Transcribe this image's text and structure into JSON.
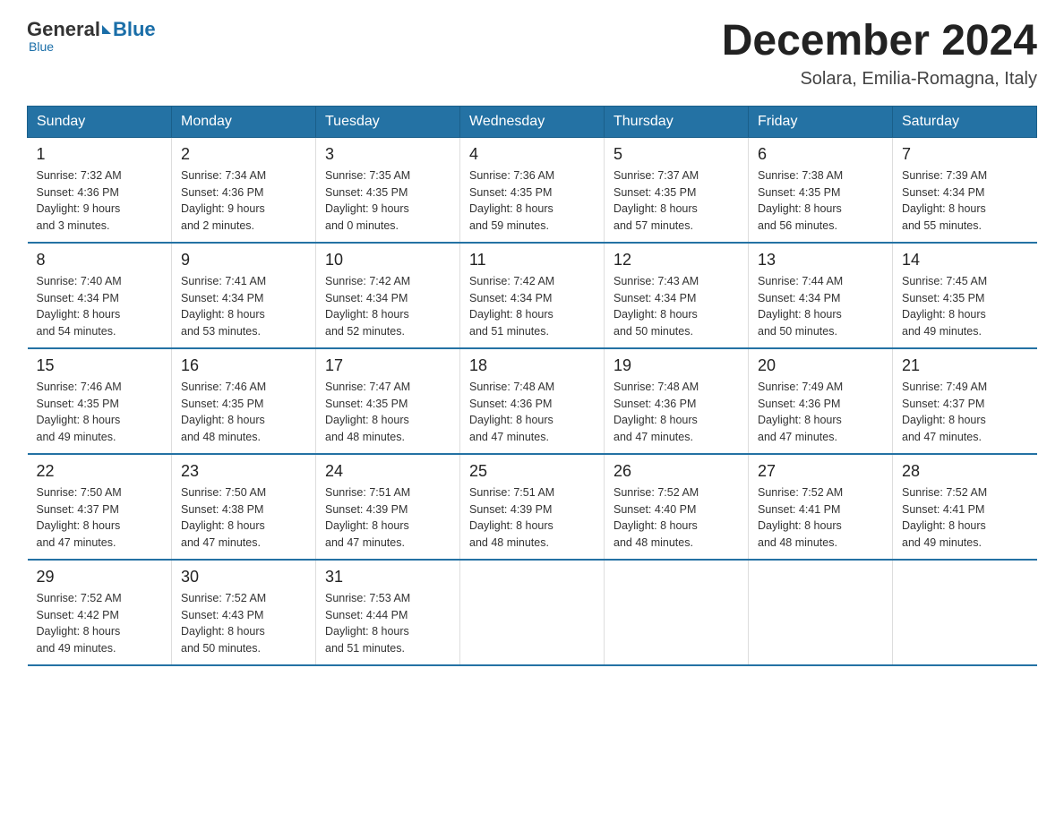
{
  "header": {
    "logo_general": "General",
    "logo_blue": "Blue",
    "month_title": "December 2024",
    "location": "Solara, Emilia-Romagna, Italy"
  },
  "days_of_week": [
    "Sunday",
    "Monday",
    "Tuesday",
    "Wednesday",
    "Thursday",
    "Friday",
    "Saturday"
  ],
  "weeks": [
    [
      {
        "day": "1",
        "sunrise": "7:32 AM",
        "sunset": "4:36 PM",
        "daylight": "9 hours and 3 minutes."
      },
      {
        "day": "2",
        "sunrise": "7:34 AM",
        "sunset": "4:36 PM",
        "daylight": "9 hours and 2 minutes."
      },
      {
        "day": "3",
        "sunrise": "7:35 AM",
        "sunset": "4:35 PM",
        "daylight": "9 hours and 0 minutes."
      },
      {
        "day": "4",
        "sunrise": "7:36 AM",
        "sunset": "4:35 PM",
        "daylight": "8 hours and 59 minutes."
      },
      {
        "day": "5",
        "sunrise": "7:37 AM",
        "sunset": "4:35 PM",
        "daylight": "8 hours and 57 minutes."
      },
      {
        "day": "6",
        "sunrise": "7:38 AM",
        "sunset": "4:35 PM",
        "daylight": "8 hours and 56 minutes."
      },
      {
        "day": "7",
        "sunrise": "7:39 AM",
        "sunset": "4:34 PM",
        "daylight": "8 hours and 55 minutes."
      }
    ],
    [
      {
        "day": "8",
        "sunrise": "7:40 AM",
        "sunset": "4:34 PM",
        "daylight": "8 hours and 54 minutes."
      },
      {
        "day": "9",
        "sunrise": "7:41 AM",
        "sunset": "4:34 PM",
        "daylight": "8 hours and 53 minutes."
      },
      {
        "day": "10",
        "sunrise": "7:42 AM",
        "sunset": "4:34 PM",
        "daylight": "8 hours and 52 minutes."
      },
      {
        "day": "11",
        "sunrise": "7:42 AM",
        "sunset": "4:34 PM",
        "daylight": "8 hours and 51 minutes."
      },
      {
        "day": "12",
        "sunrise": "7:43 AM",
        "sunset": "4:34 PM",
        "daylight": "8 hours and 50 minutes."
      },
      {
        "day": "13",
        "sunrise": "7:44 AM",
        "sunset": "4:34 PM",
        "daylight": "8 hours and 50 minutes."
      },
      {
        "day": "14",
        "sunrise": "7:45 AM",
        "sunset": "4:35 PM",
        "daylight": "8 hours and 49 minutes."
      }
    ],
    [
      {
        "day": "15",
        "sunrise": "7:46 AM",
        "sunset": "4:35 PM",
        "daylight": "8 hours and 49 minutes."
      },
      {
        "day": "16",
        "sunrise": "7:46 AM",
        "sunset": "4:35 PM",
        "daylight": "8 hours and 48 minutes."
      },
      {
        "day": "17",
        "sunrise": "7:47 AM",
        "sunset": "4:35 PM",
        "daylight": "8 hours and 48 minutes."
      },
      {
        "day": "18",
        "sunrise": "7:48 AM",
        "sunset": "4:36 PM",
        "daylight": "8 hours and 47 minutes."
      },
      {
        "day": "19",
        "sunrise": "7:48 AM",
        "sunset": "4:36 PM",
        "daylight": "8 hours and 47 minutes."
      },
      {
        "day": "20",
        "sunrise": "7:49 AM",
        "sunset": "4:36 PM",
        "daylight": "8 hours and 47 minutes."
      },
      {
        "day": "21",
        "sunrise": "7:49 AM",
        "sunset": "4:37 PM",
        "daylight": "8 hours and 47 minutes."
      }
    ],
    [
      {
        "day": "22",
        "sunrise": "7:50 AM",
        "sunset": "4:37 PM",
        "daylight": "8 hours and 47 minutes."
      },
      {
        "day": "23",
        "sunrise": "7:50 AM",
        "sunset": "4:38 PM",
        "daylight": "8 hours and 47 minutes."
      },
      {
        "day": "24",
        "sunrise": "7:51 AM",
        "sunset": "4:39 PM",
        "daylight": "8 hours and 47 minutes."
      },
      {
        "day": "25",
        "sunrise": "7:51 AM",
        "sunset": "4:39 PM",
        "daylight": "8 hours and 48 minutes."
      },
      {
        "day": "26",
        "sunrise": "7:52 AM",
        "sunset": "4:40 PM",
        "daylight": "8 hours and 48 minutes."
      },
      {
        "day": "27",
        "sunrise": "7:52 AM",
        "sunset": "4:41 PM",
        "daylight": "8 hours and 48 minutes."
      },
      {
        "day": "28",
        "sunrise": "7:52 AM",
        "sunset": "4:41 PM",
        "daylight": "8 hours and 49 minutes."
      }
    ],
    [
      {
        "day": "29",
        "sunrise": "7:52 AM",
        "sunset": "4:42 PM",
        "daylight": "8 hours and 49 minutes."
      },
      {
        "day": "30",
        "sunrise": "7:52 AM",
        "sunset": "4:43 PM",
        "daylight": "8 hours and 50 minutes."
      },
      {
        "day": "31",
        "sunrise": "7:53 AM",
        "sunset": "4:44 PM",
        "daylight": "8 hours and 51 minutes."
      },
      null,
      null,
      null,
      null
    ]
  ],
  "labels": {
    "sunrise": "Sunrise:",
    "sunset": "Sunset:",
    "daylight": "Daylight:"
  }
}
